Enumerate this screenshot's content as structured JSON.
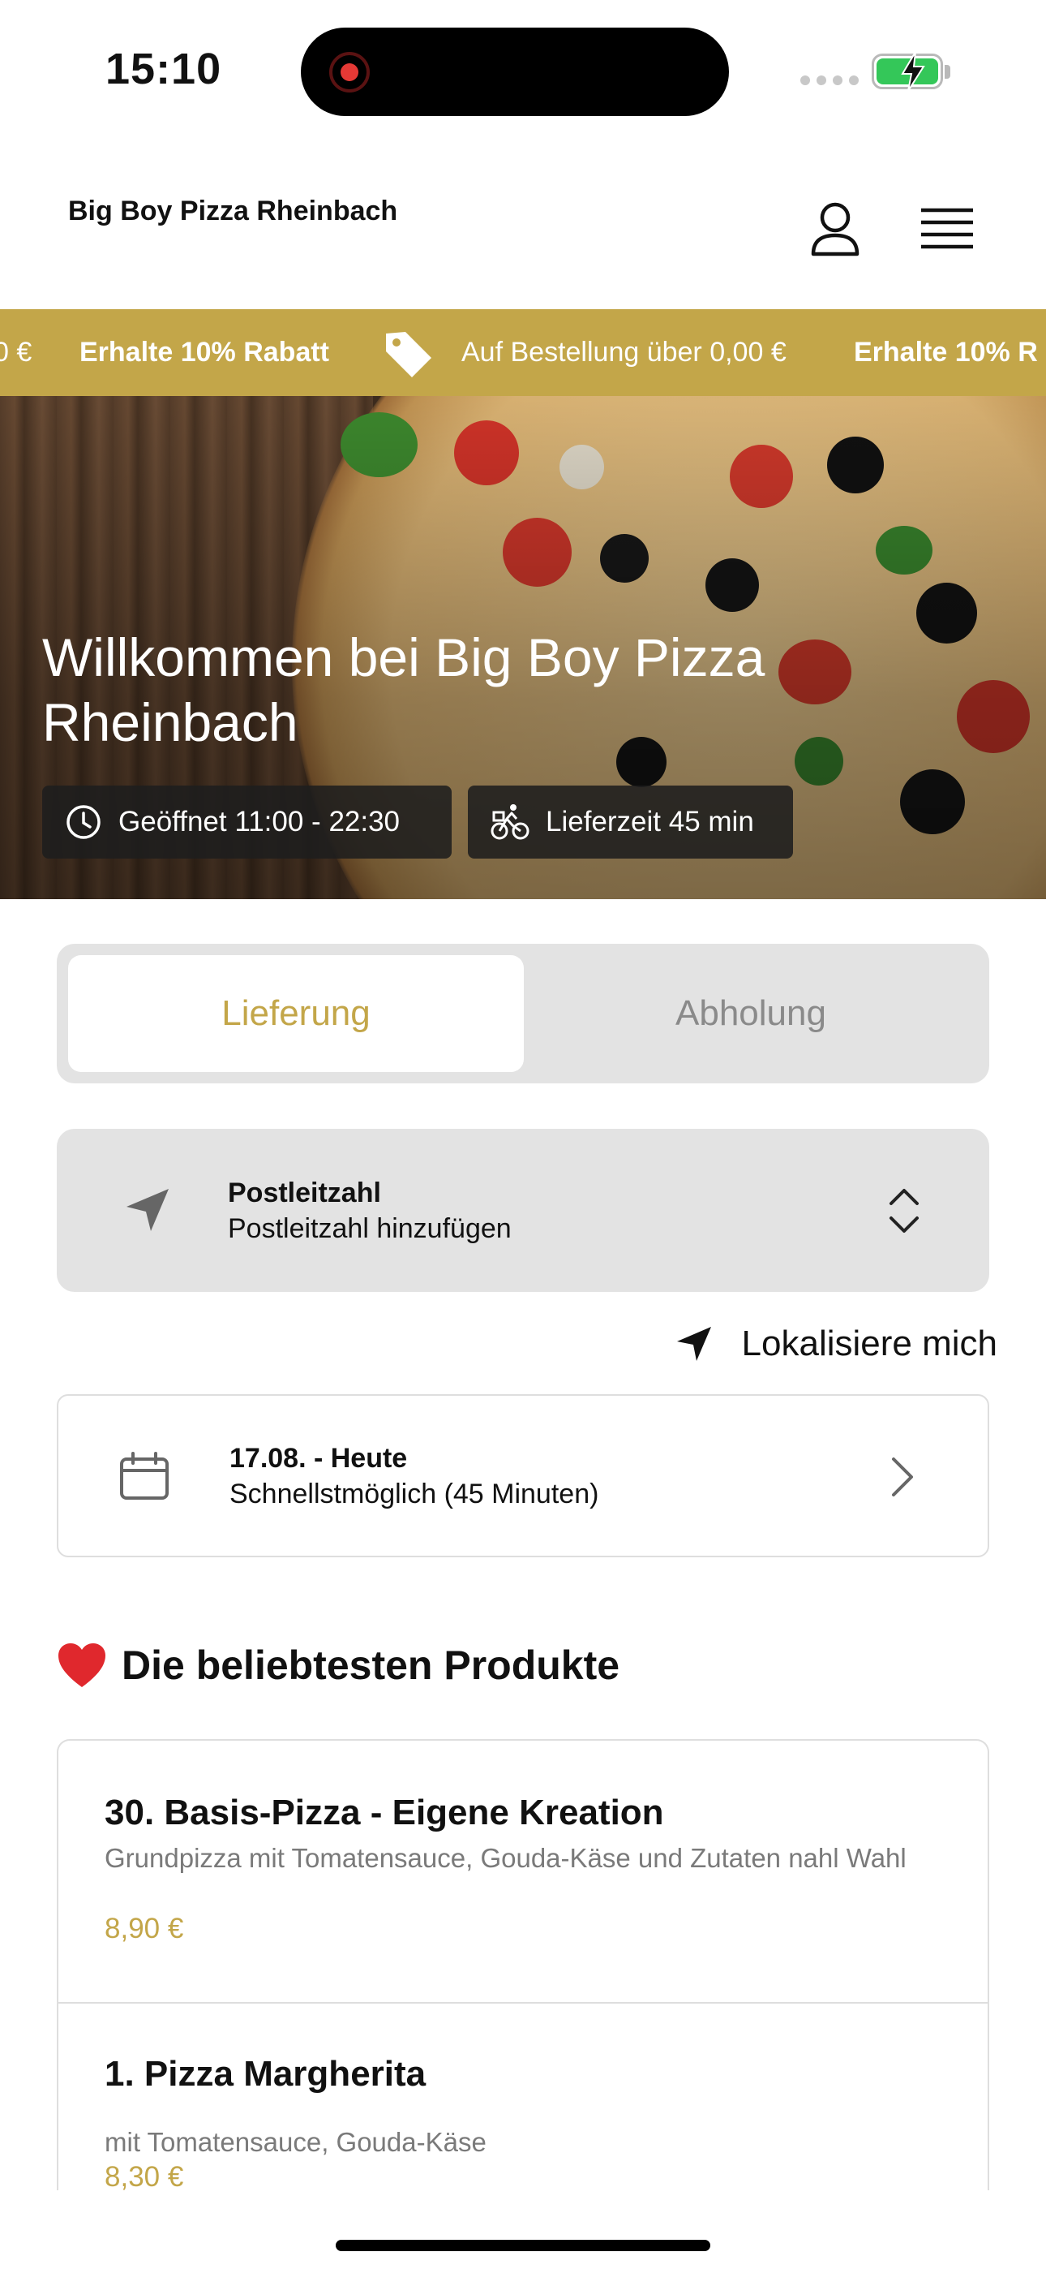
{
  "status_bar": {
    "time": "15:10",
    "battery_state": "charging",
    "battery_color": "#34c759"
  },
  "header": {
    "brand_name": "Big Boy Pizza Rheinbach",
    "account_icon": "person-icon",
    "menu_icon": "hamburger-menu-icon"
  },
  "promo_banner": {
    "leading_fragment": "0 €",
    "promo_bold": "Erhalte 10% Rabatt",
    "promo_condition": "Auf Bestellung über 0,00 €",
    "trailing_fragment": "Erhalte 10% R",
    "background_color": "#c3a649"
  },
  "hero": {
    "title": "Willkommen bei Big Boy Pizza Rheinbach",
    "opening_hours": "Geöffnet 11:00 - 22:30",
    "delivery_time": "Lieferzeit 45 min"
  },
  "order_type": {
    "tabs": [
      {
        "label": "Lieferung",
        "active": true
      },
      {
        "label": "Abholung",
        "active": false
      }
    ],
    "accent_color": "#c3a649"
  },
  "postcode": {
    "label": "Postleitzahl",
    "value": "Postleitzahl hinzufügen"
  },
  "locate_me": {
    "label": "Lokalisiere mich"
  },
  "delivery_date": {
    "label": "17.08. - Heute",
    "value": "Schnellstmöglich (45 Minuten)"
  },
  "popular_products": {
    "title": "Die beliebtesten Produkte",
    "items": [
      {
        "name": "30. Basis-Pizza - Eigene Kreation",
        "description": "Grundpizza mit Tomatensauce, Gouda-Käse und Zutaten nahl Wahl",
        "price": "8,90 €"
      },
      {
        "name": "1. Pizza Margherita",
        "description": "mit Tomatensauce, Gouda-Käse",
        "price": "8,30 €"
      }
    ]
  }
}
